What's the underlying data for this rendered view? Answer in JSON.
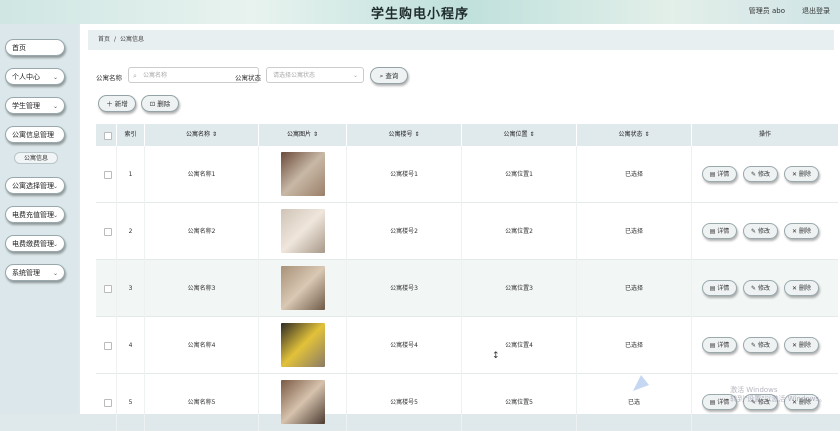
{
  "header": {
    "title": "学生购电小程序",
    "admin": "管理员 abo",
    "logout": "退出登录"
  },
  "sidebar": {
    "items": [
      {
        "label": "首页",
        "chevron": ""
      },
      {
        "label": "个人中心",
        "chevron": "⌄"
      },
      {
        "label": "学生管理",
        "chevron": "⌄"
      },
      {
        "label": "公寓信息管理",
        "chevron": ""
      },
      {
        "label": "公寓选择管理",
        "chevron": "⌄"
      },
      {
        "label": "电费充值管理",
        "chevron": "⌄"
      },
      {
        "label": "电费缴费管理",
        "chevron": "⌄"
      },
      {
        "label": "系统管理",
        "chevron": "⌄"
      }
    ],
    "sub_item": "公寓信息"
  },
  "breadcrumb": {
    "home": "首页",
    "separator": "/",
    "current": "公寓信息"
  },
  "filters": {
    "name_label": "公寓名称",
    "name_placeholder": "公寓名称",
    "status_label": "公寓状态",
    "status_placeholder": "请选择公寓状态",
    "search_button": "查询"
  },
  "toolbar": {
    "add_button": "新增",
    "delete_button": "删除"
  },
  "table": {
    "columns": [
      "索引",
      "公寓名称",
      "公寓图片",
      "公寓楼号",
      "公寓位置",
      "公寓状态",
      "操作"
    ],
    "rows": [
      {
        "index": "1",
        "name": "公寓名称1",
        "building": "公寓楼号1",
        "location": "公寓位置1",
        "status": "已选择"
      },
      {
        "index": "2",
        "name": "公寓名称2",
        "building": "公寓楼号2",
        "location": "公寓位置2",
        "status": "已选择"
      },
      {
        "index": "3",
        "name": "公寓名称3",
        "building": "公寓楼号3",
        "location": "公寓位置3",
        "status": "已选择"
      },
      {
        "index": "4",
        "name": "公寓名称4",
        "building": "公寓楼号4",
        "location": "公寓位置4",
        "status": "已选择"
      },
      {
        "index": "5",
        "name": "公寓名称5",
        "building": "公寓楼号5",
        "location": "公寓位置5",
        "status": "已选"
      }
    ],
    "actions": {
      "detail": "详情",
      "edit": "修改",
      "delete": "删除"
    }
  },
  "watermark": {
    "line1": "激活 Windows",
    "line2": "转到\"设置\"以激活 Windows。"
  },
  "colors": {
    "sidebar_bg": "#dbe7ea",
    "header_bg": "#cfe6e3",
    "table_head": "#e0e9ec"
  }
}
